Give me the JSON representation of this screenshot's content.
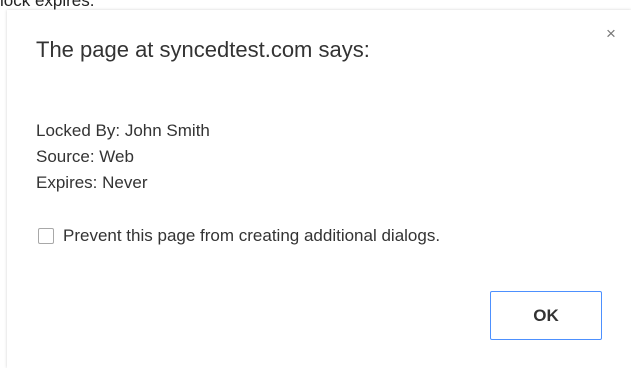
{
  "background": {
    "partial_text": "lock expires."
  },
  "dialog": {
    "title": "The page at syncedtest.com says:",
    "close_glyph": "×",
    "message_lines": [
      "Locked By: John Smith",
      "Source: Web",
      "Expires: Never"
    ],
    "prevent_checkbox": {
      "label": "Prevent this page from creating additional dialogs.",
      "checked": false
    },
    "ok_label": "OK"
  },
  "colors": {
    "ok_border": "#4d90fe",
    "text": "#333333"
  }
}
